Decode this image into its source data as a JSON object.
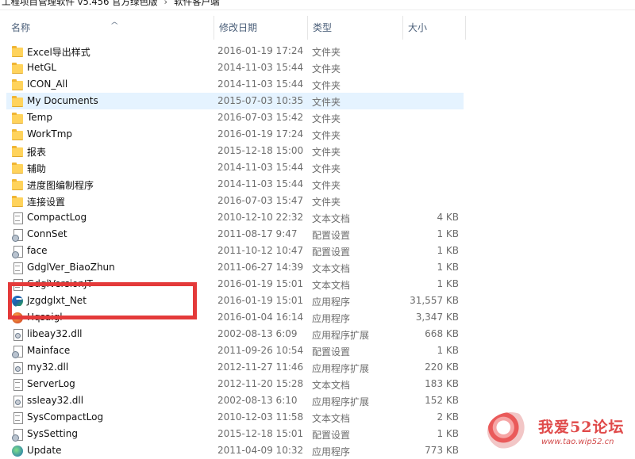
{
  "breadcrumb": {
    "parent": "工程项目管理软件 v5.456 官方绿色版",
    "current": "软件客户端"
  },
  "columns": {
    "name": "名称",
    "date": "修改日期",
    "type": "类型",
    "size": "大小"
  },
  "files": [
    {
      "name": "Excel导出样式",
      "date": "2016-01-19 17:24",
      "type": "文件夹",
      "size": "",
      "icon": "folder"
    },
    {
      "name": "HetGL",
      "date": "2014-11-03 15:44",
      "type": "文件夹",
      "size": "",
      "icon": "folder"
    },
    {
      "name": "ICON_All",
      "date": "2014-11-03 15:44",
      "type": "文件夹",
      "size": "",
      "icon": "folder"
    },
    {
      "name": "My Documents",
      "date": "2015-07-03 10:35",
      "type": "文件夹",
      "size": "",
      "icon": "folder",
      "selected": true
    },
    {
      "name": "Temp",
      "date": "2016-07-03 15:42",
      "type": "文件夹",
      "size": "",
      "icon": "folder"
    },
    {
      "name": "WorkTmp",
      "date": "2016-01-19 17:24",
      "type": "文件夹",
      "size": "",
      "icon": "folder"
    },
    {
      "name": "报表",
      "date": "2015-12-18 15:00",
      "type": "文件夹",
      "size": "",
      "icon": "folder"
    },
    {
      "name": "辅助",
      "date": "2014-11-03 15:44",
      "type": "文件夹",
      "size": "",
      "icon": "folder"
    },
    {
      "name": "进度图编制程序",
      "date": "2014-11-03 15:44",
      "type": "文件夹",
      "size": "",
      "icon": "folder"
    },
    {
      "name": "连接设置",
      "date": "2016-07-03 15:47",
      "type": "文件夹",
      "size": "",
      "icon": "folder"
    },
    {
      "name": "CompactLog",
      "date": "2010-12-10 22:32",
      "type": "文本文档",
      "size": "4 KB",
      "icon": "text-file"
    },
    {
      "name": "ConnSet",
      "date": "2011-08-17 9:47",
      "type": "配置设置",
      "size": "1 KB",
      "icon": "config-file"
    },
    {
      "name": "face",
      "date": "2011-10-12 10:47",
      "type": "配置设置",
      "size": "1 KB",
      "icon": "config-file"
    },
    {
      "name": "GdglVer_BiaoZhun",
      "date": "2011-06-27 14:39",
      "type": "文本文档",
      "size": "1 KB",
      "icon": "text-file"
    },
    {
      "name": "GdglVersionJT",
      "date": "2016-01-19 15:01",
      "type": "文本文档",
      "size": "1 KB",
      "icon": "text-file"
    },
    {
      "name": "Jzgdglxt_Net",
      "date": "2016-01-19 15:01",
      "type": "应用程序",
      "size": "31,557 KB",
      "icon": "app-s"
    },
    {
      "name": "Hqsaigl",
      "date": "2016-01-04 16:14",
      "type": "应用程序",
      "size": "3,347 KB",
      "icon": "app-red"
    },
    {
      "name": "libeay32.dll",
      "date": "2002-08-13 6:09",
      "type": "应用程序扩展",
      "size": "668 KB",
      "icon": "dll-file"
    },
    {
      "name": "Mainface",
      "date": "2011-09-26 10:54",
      "type": "配置设置",
      "size": "1 KB",
      "icon": "config-file"
    },
    {
      "name": "my32.dll",
      "date": "2012-11-27 11:46",
      "type": "应用程序扩展",
      "size": "220 KB",
      "icon": "dll-file"
    },
    {
      "name": "ServerLog",
      "date": "2012-11-20 15:28",
      "type": "文本文档",
      "size": "183 KB",
      "icon": "text-file"
    },
    {
      "name": "ssleay32.dll",
      "date": "2002-08-13 6:10",
      "type": "应用程序扩展",
      "size": "152 KB",
      "icon": "dll-file"
    },
    {
      "name": "SysCompactLog",
      "date": "2010-12-03 11:58",
      "type": "文本文档",
      "size": "2 KB",
      "icon": "text-file"
    },
    {
      "name": "SysSetting",
      "date": "2015-12-18 15:01",
      "type": "配置设置",
      "size": "1 KB",
      "icon": "config-file"
    },
    {
      "name": "Update",
      "date": "2011-04-09 10:32",
      "type": "应用程序",
      "size": "773 KB",
      "icon": "app-globe"
    }
  ],
  "watermark": {
    "title": "我爱52论坛",
    "url": "www.tao.wip52.cn"
  },
  "colors": {
    "selected_row": "#e5f3ff",
    "folder": "#ffd35c",
    "annotation_box": "#e43a3a",
    "header_text": "#4c607a"
  }
}
